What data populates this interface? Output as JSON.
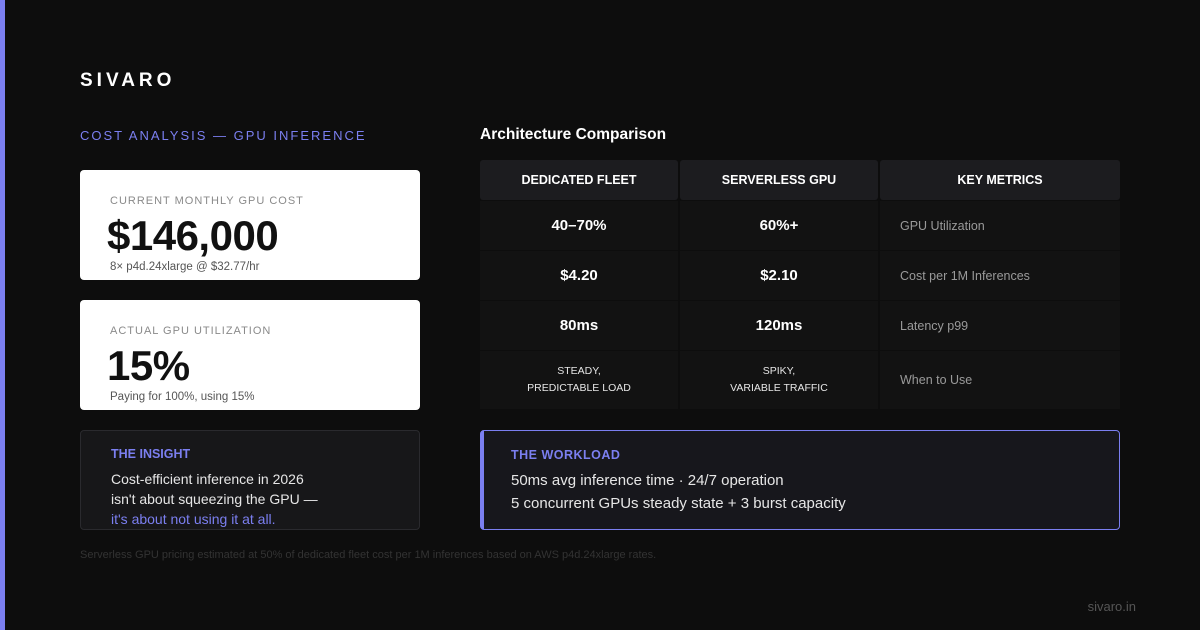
{
  "brand": "SIVARO",
  "section_label": "COST ANALYSIS — GPU INFERENCE",
  "cost_card": {
    "label": "CURRENT MONTHLY GPU COST",
    "value": "$146,000",
    "sub": "8× p4d.24xlarge @ $32.77/hr"
  },
  "util_card": {
    "label": "ACTUAL GPU UTILIZATION",
    "value": "15%",
    "sub": "Paying for 100%, using 15%"
  },
  "insight": {
    "title": "THE INSIGHT",
    "line1": "Cost-efficient inference in 2026",
    "line2": "isn't about squeezing the GPU —",
    "line3": "it's about not using it at all."
  },
  "comparison": {
    "title": "Architecture Comparison",
    "headers": [
      "DEDICATED FLEET",
      "SERVERLESS GPU",
      "KEY METRICS"
    ],
    "rows": [
      {
        "dedicated": "40–70%",
        "serverless": "60%+",
        "metric": "GPU Utilization"
      },
      {
        "dedicated": "$4.20",
        "serverless": "$2.10",
        "metric": "Cost per 1M Inferences"
      },
      {
        "dedicated": "80ms",
        "serverless": "120ms",
        "metric": "Latency p99"
      },
      {
        "dedicated_l1": "STEADY,",
        "dedicated_l2": "PREDICTABLE LOAD",
        "serverless_l1": "SPIKY,",
        "serverless_l2": "VARIABLE TRAFFIC",
        "metric": "When to Use"
      }
    ]
  },
  "workload": {
    "title": "THE WORKLOAD",
    "line1": "50ms avg inference time · 24/7 operation",
    "line2": "5 concurrent GPUs steady state + 3 burst capacity"
  },
  "footnote": "Serverless GPU pricing estimated at 50% of dedicated fleet cost per 1M inferences based on AWS p4d.24xlarge rates.",
  "site": "sivaro.in",
  "colors": {
    "accent": "#7b7ff0",
    "background": "#0d0d0d",
    "card": "#ffffff"
  }
}
